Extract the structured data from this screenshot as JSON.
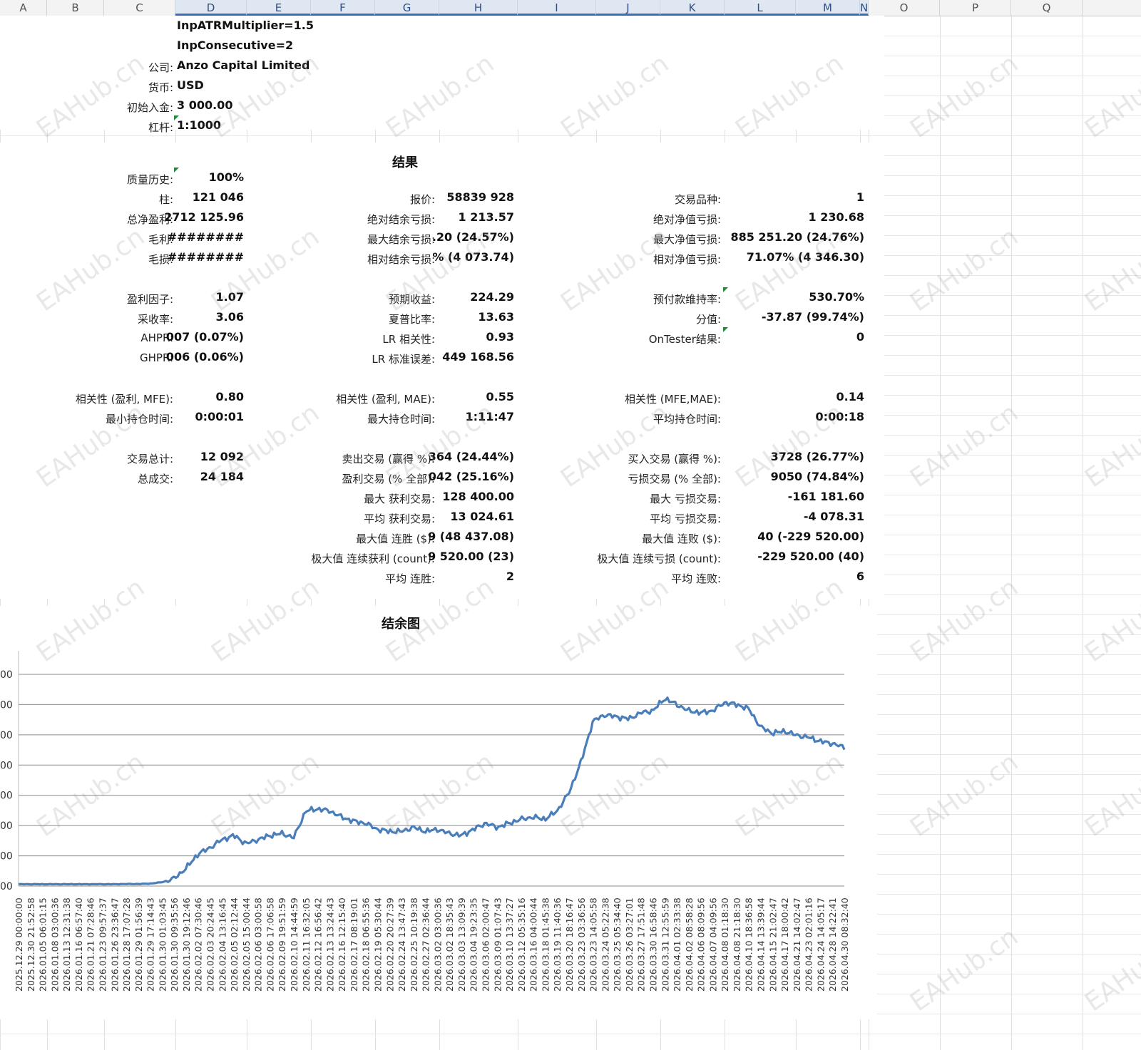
{
  "columns": [
    "A",
    "B",
    "C",
    "D",
    "E",
    "F",
    "G",
    "H",
    "I",
    "J",
    "K",
    "L",
    "M",
    "N",
    "O",
    "P",
    "Q"
  ],
  "header_params": [
    {
      "label": "",
      "value": "InpATRMultiplier=1.5"
    },
    {
      "label": "",
      "value": "InpConsecutive=2"
    },
    {
      "label": "公司:",
      "value": "Anzo Capital Limited"
    },
    {
      "label": "货币:",
      "value": "USD"
    },
    {
      "label": "初始入金:",
      "value": "3 000.00"
    },
    {
      "label": "杠杆:",
      "value": "1:1000"
    }
  ],
  "results_title": "结果",
  "col1": [
    {
      "label": "质量历史:",
      "value": "100%"
    },
    {
      "label": "柱:",
      "value": "121 046"
    },
    {
      "label": "总净盈利:",
      "value": "2712 125.96"
    },
    {
      "label": "毛利:",
      "value": "########"
    },
    {
      "label": "毛损:",
      "value": "########"
    },
    {
      "label": "盈利因子:",
      "value": "1.07"
    },
    {
      "label": "采收率:",
      "value": "3.06"
    },
    {
      "label": "AHPR:",
      "value": "007 (0.07%)"
    },
    {
      "label": "GHPR:",
      "value": "006 (0.06%)"
    },
    {
      "label": "相关性 (盈利, MFE):",
      "value": "0.80"
    },
    {
      "label": "最小持仓时间:",
      "value": "0:00:01"
    },
    {
      "label": "交易总计:",
      "value": "12 092"
    },
    {
      "label": "总成交:",
      "value": "24 184"
    }
  ],
  "col2": [
    {
      "label": "报价:",
      "value": "58839 928"
    },
    {
      "label": "绝对结余亏损:",
      "value": "1 213.57"
    },
    {
      "label": "最大结余亏损:",
      "value": ".20 (24.57%)"
    },
    {
      "label": "相对结余亏损:",
      "value": "% (4 073.74)"
    },
    {
      "label": "预期收益:",
      "value": "224.29"
    },
    {
      "label": "夏普比率:",
      "value": "13.63"
    },
    {
      "label": "LR 相关性:",
      "value": "0.93"
    },
    {
      "label": "LR 标准误差:",
      "value": "449 168.56"
    },
    {
      "label": "相关性 (盈利, MAE):",
      "value": "0.55"
    },
    {
      "label": "最大持仓时间:",
      "value": "1:11:47"
    },
    {
      "label": "卖出交易 (赢得 %):",
      "value": "364 (24.44%)"
    },
    {
      "label": "盈利交易 (% 全部):",
      "value": "042 (25.16%)"
    },
    {
      "label": "最大 获利交易:",
      "value": "128 400.00"
    },
    {
      "label": "平均 获利交易:",
      "value": "13 024.61"
    },
    {
      "label": "最大值 连胜 ($):",
      "value": "9 (48 437.08)"
    },
    {
      "label": "极大值 连续获利 (count):",
      "value": "9 520.00 (23)"
    },
    {
      "label": "平均 连胜:",
      "value": "2"
    }
  ],
  "col3": [
    {
      "label": "交易品种:",
      "value": "1"
    },
    {
      "label": "绝对净值亏损:",
      "value": "1 230.68"
    },
    {
      "label": "最大净值亏损:",
      "value": "885 251.20 (24.76%)"
    },
    {
      "label": "相对净值亏损:",
      "value": "71.07% (4 346.30)"
    },
    {
      "label": "预付款维持率:",
      "value": "530.70%"
    },
    {
      "label": "分值:",
      "value": "-37.87 (99.74%)"
    },
    {
      "label": "OnTester结果:",
      "value": "0"
    },
    {
      "label": "相关性 (MFE,MAE):",
      "value": "0.14"
    },
    {
      "label": "平均持仓时间:",
      "value": "0:00:18"
    },
    {
      "label": "买入交易 (赢得 %):",
      "value": "3728 (26.77%)"
    },
    {
      "label": "亏损交易 (% 全部):",
      "value": "9050 (74.84%)"
    },
    {
      "label": "最大 亏损交易:",
      "value": "-161 181.60"
    },
    {
      "label": "平均 亏损交易:",
      "value": "-4 078.31"
    },
    {
      "label": "最大值 连败 ($):",
      "value": "40 (-229 520.00)"
    },
    {
      "label": "极大值 连续亏损 (count):",
      "value": "-229 520.00 (40)"
    },
    {
      "label": "平均 连败:",
      "value": "6"
    }
  ],
  "watermark_text": "EAHub.cn",
  "chart_data": {
    "type": "line",
    "title": "结余图",
    "y_tick_labels": [
      "00",
      "00",
      "00",
      "00",
      "00",
      "00",
      "00",
      "00"
    ],
    "x_tick_labels": [
      "2025.12.29 00:00:00",
      "2025.12.30 21:52:58",
      "2026.01.05 06:01:15",
      "2026.01.08 03:00:36",
      "2026.01.13 12:31:38",
      "2026.01.16 06:57:40",
      "2026.01.21 07:28:46",
      "2026.01.23 09:57:37",
      "2026.01.26 23:36:47",
      "2026.01.28 17:07:28",
      "2026.01.29 01:56:39",
      "2026.01.29 17:14:43",
      "2026.01.30 01:03:45",
      "2026.01.30 09:35:56",
      "2026.01.30 19:12:46",
      "2026.02.02 07:30:46",
      "2026.02.03 20:24:45",
      "2026.02.04 13:16:45",
      "2026.02.05 02:12:44",
      "2026.02.05 15:00:44",
      "2026.02.06 03:00:58",
      "2026.02.06 17:06:58",
      "2026.02.09 19:51:59",
      "2026.02.10 14:44:59",
      "2026.02.11 16:32:05",
      "2026.02.12 16:56:42",
      "2026.02.13 13:24:43",
      "2026.02.16 12:15:40",
      "2026.02.17 08:19:01",
      "2026.02.18 06:55:36",
      "2026.02.19 05:30:44",
      "2026.02.20 20:27:39",
      "2026.02.24 13:47:43",
      "2026.02.25 10:19:38",
      "2026.02.27 02:36:44",
      "2026.03.02 03:00:36",
      "2026.03.02 18:35:43",
      "2026.03.03 13:09:39",
      "2026.03.04 19:23:35",
      "2026.03.06 02:00:47",
      "2026.03.09 01:07:43",
      "2026.03.10 13:37:27",
      "2026.03.12 05:35:16",
      "2026.03.16 04:00:44",
      "2026.03.18 01:45:38",
      "2026.03.19 11:40:36",
      "2026.03.20 18:16:47",
      "2026.03.23 03:36:56",
      "2026.03.23 14:05:58",
      "2026.03.24 05:22:38",
      "2026.03.25 05:34:40",
      "2026.03.26 03:27:01",
      "2026.03.27 17:51:48",
      "2026.03.30 16:58:46",
      "2026.03.31 12:55:59",
      "2026.04.01 02:33:38",
      "2026.04.02 08:58:28",
      "2026.04.06 08:09:56",
      "2026.04.07 04:09:56",
      "2026.04.08 01:18:30",
      "2026.04.08 21:18:30",
      "2026.04.10 18:36:58",
      "2026.04.14 13:39:44",
      "2026.04.15 21:02:47",
      "2026.04.17 18:00:42",
      "2026.04.21 14:02:47",
      "2026.04.23 02:01:16",
      "2026.04.24 14:05:17",
      "2026.04.28 14:22:41",
      "2026.04.30 08:32:40"
    ],
    "series": [
      {
        "color": "#4a7ebb",
        "y_fraction": [
          0.002,
          0.002,
          0.002,
          0.002,
          0.002,
          0.002,
          0.002,
          0.002,
          0.002,
          0.003,
          0.003,
          0.005,
          0.012,
          0.03,
          0.08,
          0.15,
          0.18,
          0.22,
          0.24,
          0.2,
          0.22,
          0.24,
          0.25,
          0.23,
          0.36,
          0.37,
          0.36,
          0.33,
          0.31,
          0.3,
          0.27,
          0.26,
          0.26,
          0.28,
          0.26,
          0.27,
          0.25,
          0.24,
          0.27,
          0.3,
          0.28,
          0.3,
          0.32,
          0.33,
          0.32,
          0.36,
          0.45,
          0.6,
          0.8,
          0.83,
          0.82,
          0.81,
          0.84,
          0.85,
          0.91,
          0.88,
          0.85,
          0.84,
          0.85,
          0.89,
          0.88,
          0.86,
          0.77,
          0.74,
          0.75,
          0.73,
          0.72,
          0.7,
          0.69,
          0.67
        ]
      }
    ]
  }
}
